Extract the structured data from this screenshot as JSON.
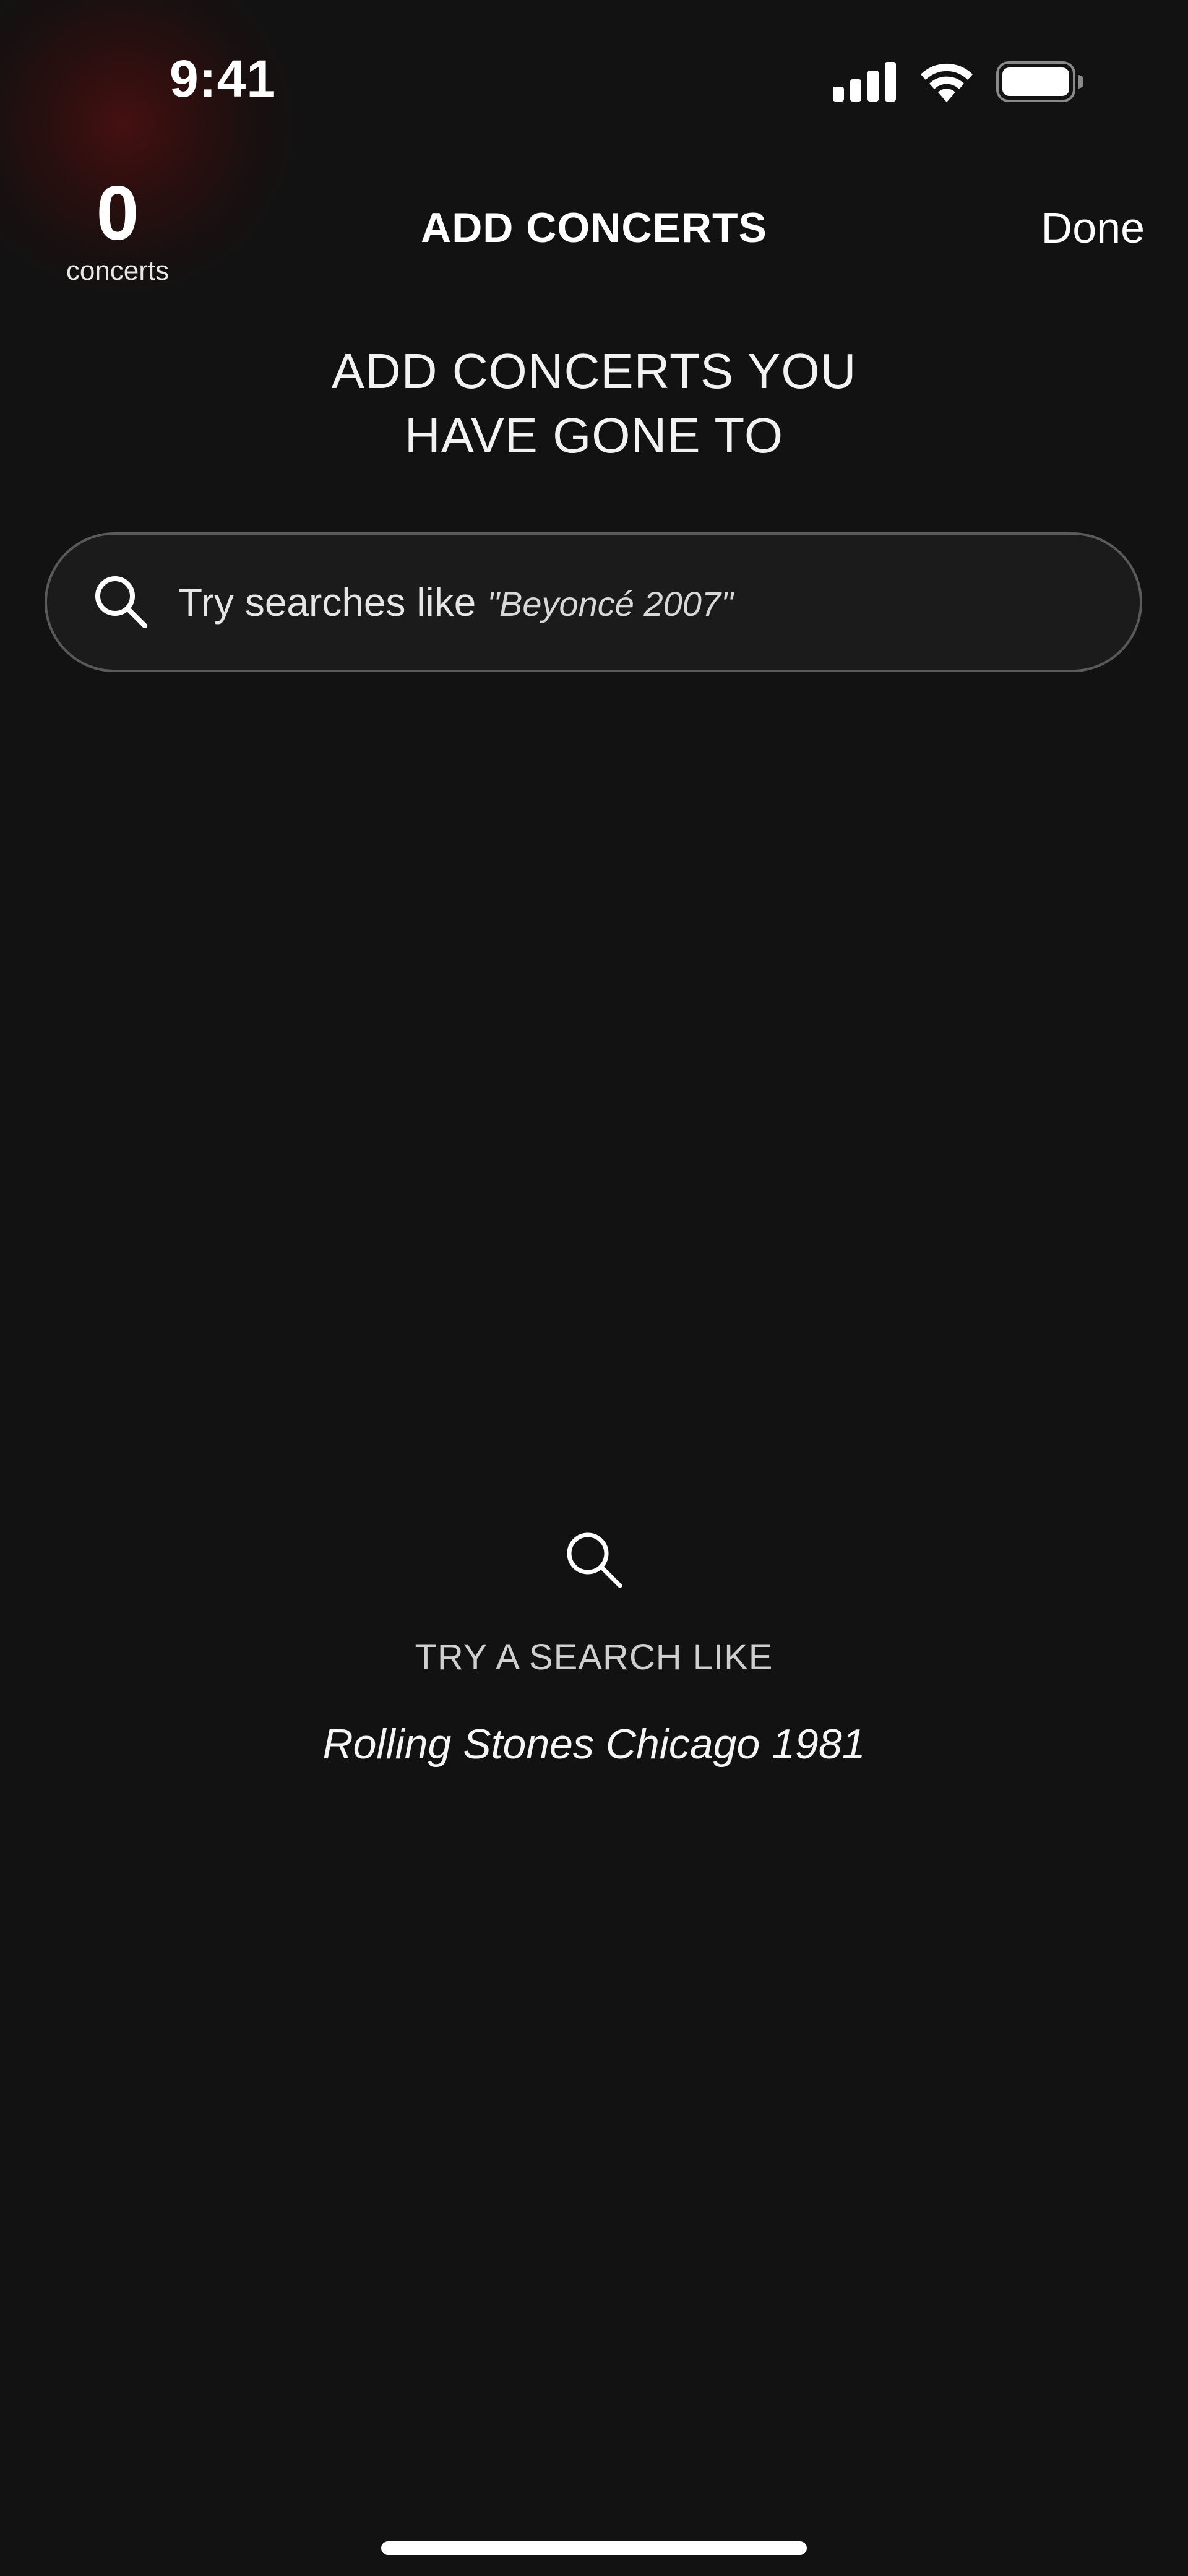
{
  "status_bar": {
    "time": "9:41",
    "icons": [
      "signal-icon",
      "wifi-icon",
      "battery-icon"
    ]
  },
  "header": {
    "concert_count": "0",
    "concert_count_label": "concerts",
    "title": "ADD CONCERTS",
    "done_label": "Done"
  },
  "prompt": {
    "line1": "ADD CONCERTS YOU",
    "line2": "HAVE GONE TO"
  },
  "search": {
    "placeholder_prefix": "Try searches like",
    "placeholder_example": "\"Beyoncé 2007\"",
    "icon": "search-icon"
  },
  "empty_state": {
    "icon": "search-icon",
    "caption": "TRY A SEARCH LIKE",
    "example": "Rolling Stones Chicago 1981"
  },
  "colors": {
    "background": "#121212",
    "text": "#ffffff",
    "accent_glow": "#6e0e0e",
    "field_border": "#5a5a5a"
  }
}
